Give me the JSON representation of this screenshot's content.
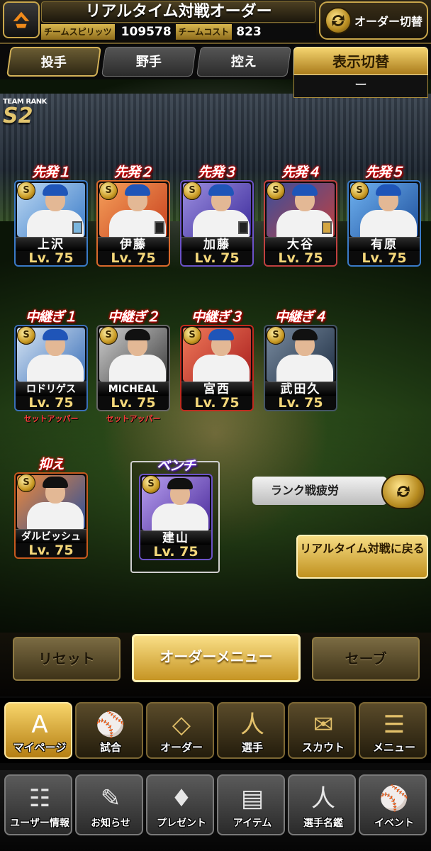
{
  "header": {
    "title": "リアルタイム対戦オーダー",
    "team_spirit_label": "チームスピリッツ",
    "team_spirit_value": "109578",
    "team_cost_label": "チームコスト",
    "team_cost_value": "823",
    "order_switch_label": "オーダー切替"
  },
  "tabs": [
    {
      "label": "投手",
      "active": true
    },
    {
      "label": "野手",
      "active": false
    },
    {
      "label": "控え",
      "active": false
    }
  ],
  "display_switch": {
    "title": "表示切替",
    "value": "ー"
  },
  "team_rank": {
    "label": "TEAM RANK",
    "value": "S2"
  },
  "starters": [
    {
      "role": "先発１",
      "name": "上沢",
      "level": "Lv. 75"
    },
    {
      "role": "先発２",
      "name": "伊藤",
      "level": "Lv. 75"
    },
    {
      "role": "先発３",
      "name": "加藤",
      "level": "Lv. 75"
    },
    {
      "role": "先発４",
      "name": "大谷",
      "level": "Lv. 75"
    },
    {
      "role": "先発５",
      "name": "有原",
      "level": "Lv. 75"
    }
  ],
  "relievers": [
    {
      "role": "中継ぎ１",
      "name": "ロドリゲス",
      "level": "Lv. 75",
      "note": "セットアッパー"
    },
    {
      "role": "中継ぎ２",
      "name": "MICHEAL",
      "level": "Lv. 75",
      "note": "セットアッパー"
    },
    {
      "role": "中継ぎ３",
      "name": "宮西",
      "level": "Lv. 75",
      "note": ""
    },
    {
      "role": "中継ぎ４",
      "name": "武田久",
      "level": "Lv. 75",
      "note": ""
    }
  ],
  "closer": {
    "role": "抑え",
    "name": "ダルビッシュ",
    "level": "Lv. 75"
  },
  "bench": {
    "role": "ベンチ",
    "name": "建山",
    "level": "Lv. 75"
  },
  "rarity_badge": "S",
  "fatigue_label": "ランク戦疲労",
  "back_button_label": "リアルタイム対戦に戻る",
  "actions": {
    "reset": "リセット",
    "order_menu": "オーダーメニュー",
    "save": "セーブ"
  },
  "main_nav": [
    {
      "label": "マイページ",
      "icon": "home-icon",
      "glyph": "A"
    },
    {
      "label": "試合",
      "icon": "stadium-icon",
      "glyph": "⚾"
    },
    {
      "label": "オーダー",
      "icon": "field-icon",
      "glyph": "◇"
    },
    {
      "label": "選手",
      "icon": "player-icon",
      "glyph": "人"
    },
    {
      "label": "スカウト",
      "icon": "scout-icon",
      "glyph": "✉"
    },
    {
      "label": "メニュー",
      "icon": "menu-icon",
      "glyph": "☰"
    }
  ],
  "sub_nav": [
    {
      "label": "ユーザー情報",
      "icon": "user-info-icon",
      "glyph": "☷"
    },
    {
      "label": "お知らせ",
      "icon": "notice-icon",
      "glyph": "✎"
    },
    {
      "label": "プレゼント",
      "icon": "present-icon",
      "glyph": "♦"
    },
    {
      "label": "アイテム",
      "icon": "item-icon",
      "glyph": "▤"
    },
    {
      "label": "選手名鑑",
      "icon": "player-book-icon",
      "glyph": "人"
    },
    {
      "label": "イベント",
      "icon": "event-icon",
      "glyph": "⚾"
    }
  ],
  "colors": {
    "gold": "#d4b258",
    "accent_red": "#ff3b3b",
    "level_yellow": "#f4d77a"
  }
}
